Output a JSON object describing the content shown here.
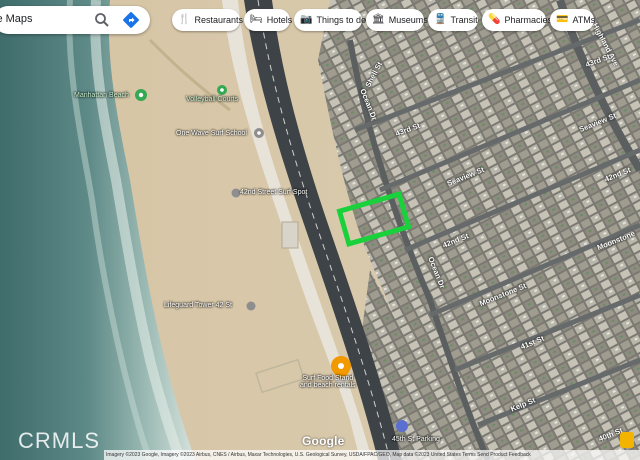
{
  "search": {
    "text": "le Maps",
    "search_icon": "search-icon",
    "directions_icon": "directions-icon"
  },
  "chips": [
    {
      "label": "Restaurants",
      "icon": "restaurant-icon"
    },
    {
      "label": "Hotels",
      "icon": "hotel-icon"
    },
    {
      "label": "Things to do",
      "icon": "camera-icon"
    },
    {
      "label": "Museums",
      "icon": "museum-icon"
    },
    {
      "label": "Transit",
      "icon": "transit-icon"
    },
    {
      "label": "Pharmacies",
      "icon": "pharmacy-icon"
    },
    {
      "label": "ATMs",
      "icon": "atm-icon"
    }
  ],
  "places": {
    "manhattan_beach": "Manhattan Beach",
    "volleyball_courts": "Volleyball Courts",
    "one_wave": "One Wave Surf School",
    "surf_spot": "42nd Street Surf Spot",
    "lifeguard_tower": "Lifeguard Tower 42 St",
    "surf_food_line1": "Surf Food Stand",
    "surf_food_line2": "and beach rentals",
    "parking": "45th St Parking"
  },
  "streets": {
    "highland": "Highland Ave",
    "shell": "Shell St",
    "rd43_a": "43rd St",
    "rd43_b": "43rd St",
    "seaview_a": "Seaview St",
    "seaview_b": "Seaview St",
    "nd42_a": "42nd St",
    "nd42_b": "42nd St",
    "moonstone_a": "Moonstone St",
    "moonstone_b": "Moonstone",
    "st41": "41st St",
    "kelp": "Kelp St",
    "st40": "40th St",
    "ocean_dr_a": "Ocean Dr",
    "ocean_dr_b": "Ocean Dr"
  },
  "branding": {
    "google": "Google",
    "attribution": "Imagery ©2023 Google, Imagery ©2023 Airbus, CNES / Airbus, Maxar Technologies, U.S. Geological Survey, USDA/FPAC/GEO, Map data ©2023   United States   Terms   Send Product Feedback",
    "watermark": "CRMLS"
  },
  "highlight": {
    "color": "#19d13a",
    "label": "subject-property"
  },
  "colors": {
    "ocean_deep": "#4f7c7a",
    "surf": "#c8dad6",
    "sand": "#d8c7a8",
    "highway": "#3e4347",
    "roofs": "#a9a59c"
  }
}
